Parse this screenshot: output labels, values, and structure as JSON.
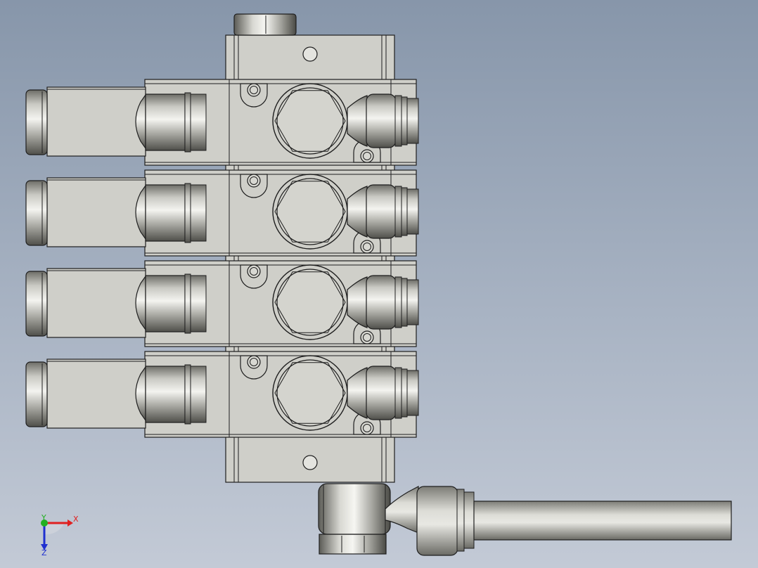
{
  "viewport": {
    "model": "solenoid-valve-manifold-4-station",
    "view": "top",
    "station_count": 4,
    "colors": {
      "bg_top": "#8796aa",
      "bg_bottom": "#c3cad6",
      "body_fill": "#cfcfc9",
      "edge": "#1e1e1e",
      "metal_dark": "#55554f",
      "metal_light": "#f2f2ee"
    }
  },
  "triad": {
    "x_label": "X",
    "y_label": "Y",
    "z_label": "Z",
    "x_color": "#e02020",
    "y_color": "#20b020",
    "z_color": "#2030d0"
  }
}
